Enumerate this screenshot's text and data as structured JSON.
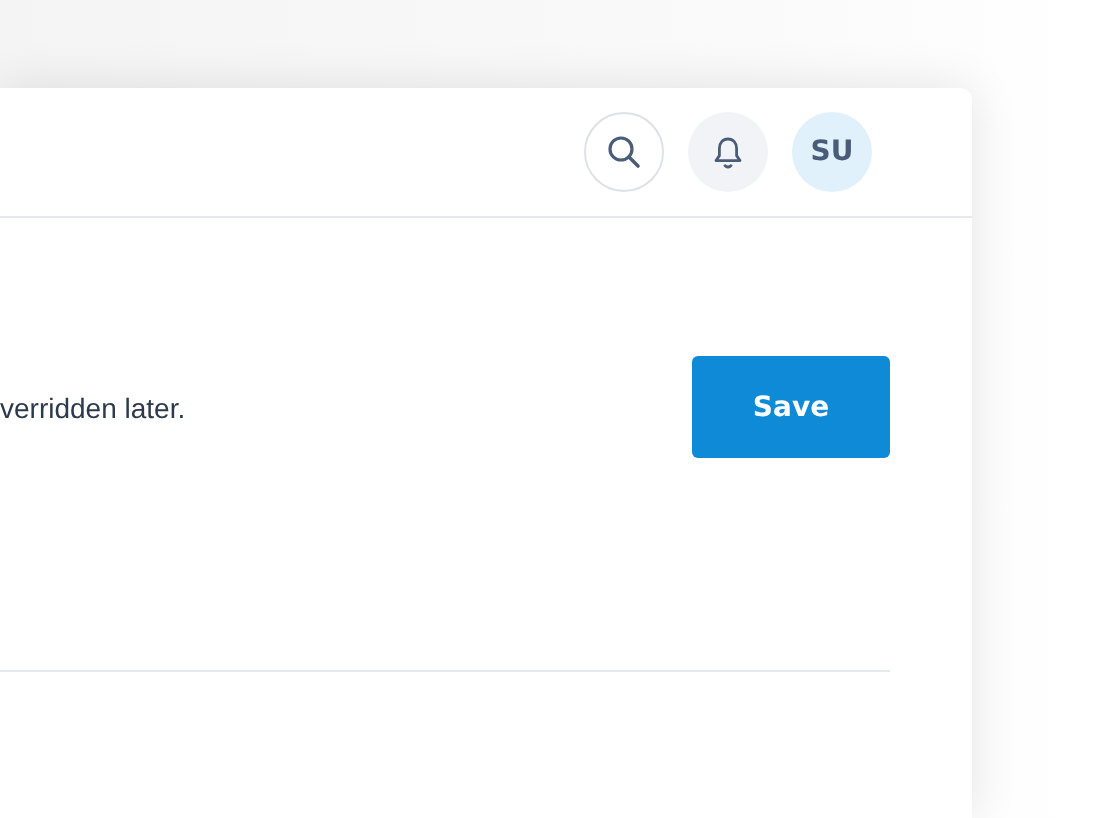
{
  "header": {
    "avatar_initials": "SU"
  },
  "content": {
    "description": "verridden later.",
    "save_button": "Save"
  }
}
